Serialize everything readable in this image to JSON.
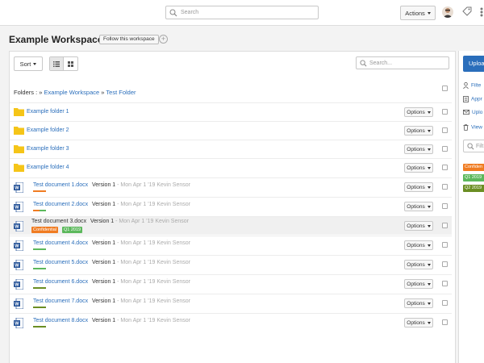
{
  "topbar": {
    "search_placeholder": "Search",
    "actions_label": "Actions"
  },
  "workspace": {
    "title": "Example Workspace",
    "follow_label": "Follow this workspace",
    "plus": "+"
  },
  "toolbar": {
    "sort_label": "Sort",
    "search_placeholder": "Search..."
  },
  "breadcrumb": {
    "prefix": "Folders :",
    "sep1": "»",
    "crumb1": "Example Workspace",
    "sep2": "»",
    "crumb2": "Test Folder"
  },
  "options_label": "Options",
  "folders": [
    {
      "name": "Example folder 1"
    },
    {
      "name": "Example folder 2"
    },
    {
      "name": "Example folder 3"
    },
    {
      "name": "Example folder 4"
    }
  ],
  "documents": [
    {
      "name": "Test document 1.docx",
      "version": "Version 1",
      "meta": " - Mon Apr 1 '19  Kevin Sensor",
      "accent": "#f07c22"
    },
    {
      "name": "Test document 2.docx",
      "version": "Version 1",
      "meta": " - Mon Apr 1 '19  Kevin Sensor",
      "accent": "#f07c22"
    },
    {
      "name": "Test document 3.docx",
      "version": "Version 1",
      "meta": " - Mon Apr 1 '19  Kevin Sensor",
      "badges": [
        {
          "text": "Confidential",
          "color": "#f07c22"
        },
        {
          "text": "Q1 2019",
          "color": "#5cb85c"
        }
      ]
    },
    {
      "name": "Test document 4.docx",
      "version": "Version 1",
      "meta": " - Mon Apr 1 '19  Kevin Sensor",
      "accent": "#5cb85c"
    },
    {
      "name": "Test document 5.docx",
      "version": "Version 1",
      "meta": " - Mon Apr 1 '19  Kevin Sensor",
      "accent": "#5cb85c"
    },
    {
      "name": "Test document 6.docx",
      "version": "Version 1",
      "meta": " - Mon Apr 1 '19  Kevin Sensor",
      "accent": "#6b8e23"
    },
    {
      "name": "Test document 7.docx",
      "version": "Version 1",
      "meta": " - Mon Apr 1 '19  Kevin Sensor",
      "accent": "#6b8e23"
    },
    {
      "name": "Test document 8.docx",
      "version": "Version 1",
      "meta": " - Mon Apr 1 '19  Kevin Sensor",
      "accent": "#6b8e23"
    }
  ],
  "right_panel": {
    "upload_label": "Uploa",
    "filter_label": "Filte",
    "approve_label": "Appr",
    "upload_email_label": "Uplo",
    "view_label": "View",
    "filter_placeholder": "Filt",
    "tags": [
      {
        "text": "Confiden",
        "color": "#f07c22"
      },
      {
        "text": "Q1 2019",
        "color": "#5cb85c"
      },
      {
        "text": "Q2 2019",
        "color": "#6b8e23"
      }
    ]
  }
}
